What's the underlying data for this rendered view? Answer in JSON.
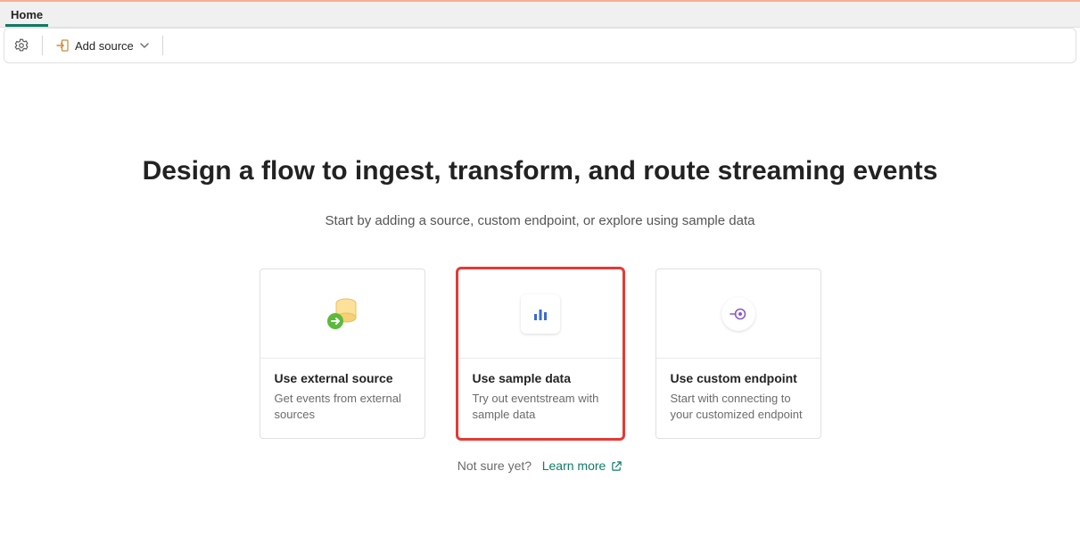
{
  "ribbon": {
    "tabs": [
      {
        "label": "Home"
      }
    ]
  },
  "toolbar": {
    "add_source_label": "Add source"
  },
  "main": {
    "headline": "Design a flow to ingest, transform, and route streaming events",
    "subhead": "Start by adding a source, custom endpoint, or explore using sample data",
    "cards": [
      {
        "title": "Use external source",
        "desc": "Get events from external sources",
        "icon": "external-source-icon"
      },
      {
        "title": "Use sample data",
        "desc": "Try out eventstream with sample data",
        "icon": "sample-data-icon",
        "highlighted": true
      },
      {
        "title": "Use custom endpoint",
        "desc": "Start with connecting to your customized endpoint",
        "icon": "custom-endpoint-icon"
      }
    ],
    "footer": {
      "prefix": "Not sure yet?",
      "link_label": "Learn more"
    }
  }
}
